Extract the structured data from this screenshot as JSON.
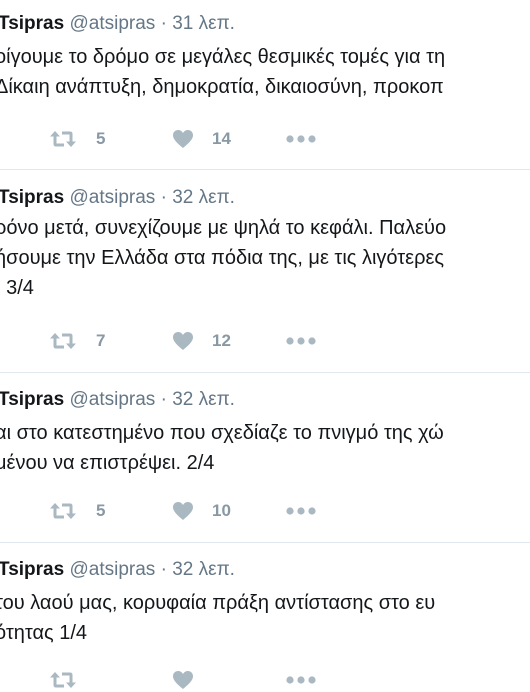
{
  "tweets": [
    {
      "name": "Tsipras",
      "handle": "@atsipras",
      "separator": "·",
      "time": "31 λεπ.",
      "lines": [
        "οίγουμε το δρόμο σε μεγάλες θεσμικές τομές για τη",
        "Δίκαιη ανάπτυξη, δημοκρατία, δικαιοσύνη, προκοπ"
      ],
      "retweets": "5",
      "likes": "14"
    },
    {
      "name": "Tsipras",
      "handle": "@atsipras",
      "separator": "·",
      "time": "32 λεπ.",
      "lines": [
        "ρόνο μετά, συνεχίζουμε με ψηλά το κεφάλι. Παλεύο",
        "ήσουμε την Ελλάδα στα πόδια της, με τις λιγότερες",
        ". 3/4"
      ],
      "retweets": "7",
      "likes": "12"
    },
    {
      "name": "Tsipras",
      "handle": "@atsipras",
      "separator": "·",
      "time": "32 λεπ.",
      "lines": [
        "αι στο κατεστημένο που σχεδίαζε το πνιγμό της χώ",
        "μένου να επιστρέψει. 2/4"
      ],
      "retweets": "5",
      "likes": "10"
    },
    {
      "name": "Tsipras",
      "handle": "@atsipras",
      "separator": "·",
      "time": "32 λεπ.",
      "lines": [
        " του λαού μας, κορυφαία πράξη αντίστασης στο ευ",
        "ότητας 1/4"
      ],
      "retweets": "",
      "likes": ""
    }
  ],
  "icons": {
    "retweet": "retweet-icon",
    "like": "heart-icon",
    "more": "more-dots-icon"
  },
  "colors": {
    "icon": "#aab8c2",
    "count": "#8899a6",
    "handle": "#657786",
    "text": "#14171a",
    "divider": "#e1e8ed"
  }
}
